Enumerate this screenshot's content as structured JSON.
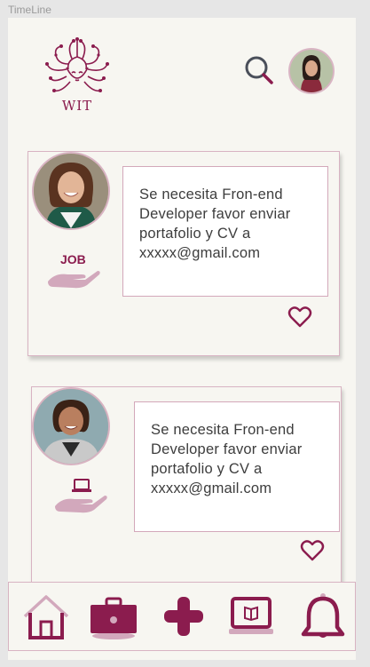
{
  "frame": {
    "label": "TimeLine"
  },
  "header": {
    "logo_text": "WIT",
    "icons": [
      "search-icon",
      "avatar"
    ]
  },
  "posts": [
    {
      "message": "Se necesita Fron-end Developer favor enviar portafolio y CV a xxxxx@gmail.com",
      "tag_label": "JOB",
      "category_icon": "hand-job-icon"
    },
    {
      "message": "Se necesita Fron-end Developer favor enviar portafolio y CV a xxxxx@gmail.com",
      "category_icon": "hand-laptop-icon"
    }
  ],
  "bottom_nav": {
    "icons": [
      "home-icon",
      "briefcase-icon",
      "plus-icon",
      "laptop-book-icon",
      "bell-icon"
    ]
  },
  "colors": {
    "accent": "#8b1c4e",
    "accent_light": "#d3a8ba",
    "background": "#f7f6f1",
    "frame_bg": "#e6e6e6"
  }
}
